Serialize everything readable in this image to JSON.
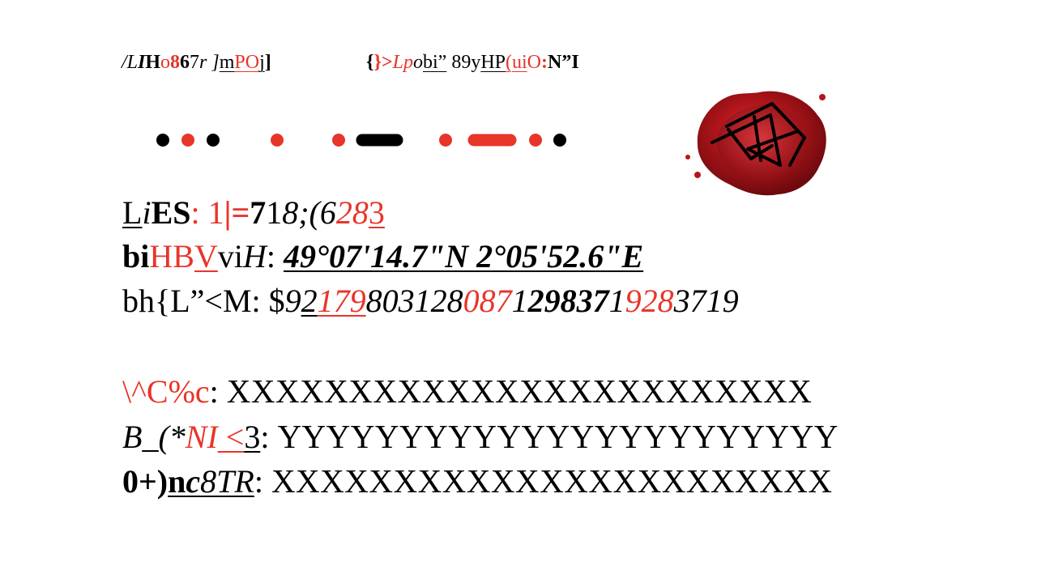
{
  "header": {
    "left": [
      "/",
      "L",
      "I",
      "H",
      "o",
      "8",
      "6",
      "7",
      "r",
      " ]",
      "m",
      "PO",
      "j",
      "]"
    ],
    "right": [
      "{",
      "}",
      ">",
      "Lp",
      "o",
      "bi",
      "”",
      " 89",
      "y",
      "HP",
      "(",
      "ui",
      "O",
      ":",
      "N”I"
    ]
  },
  "morse_colors": {
    "black": "#000000",
    "red": "#e8352a"
  },
  "morse": [
    "dot-black",
    "dot-red",
    "dot-black",
    "dot-red",
    "dot-red",
    "dash-black",
    "dot-red",
    "dash-red",
    "dot-red",
    "dot-black"
  ],
  "seal": {
    "icon": "wax-seal-icon",
    "color": "#b5161b"
  },
  "lines": {
    "l1": [
      "L",
      "i",
      "ES",
      ": 1",
      "|",
      "=",
      "7",
      "1",
      "8;(6",
      "28",
      "3"
    ],
    "l2": [
      "bi",
      "HB",
      "V",
      "vi",
      "H",
      ": ",
      "49°07'14.7\"N 2°05'52.6\"E"
    ],
    "l3": [
      "bh{L”<M: $",
      "9",
      "2",
      "179",
      "803128",
      "087",
      "1",
      "29837",
      "1",
      "928",
      "3719"
    ],
    "l4": [
      "\\^C%c",
      ": ",
      "XXXXXXXXXXXXXXXXXXXXXXXX"
    ],
    "l5": [
      "B",
      "_(*",
      "NI",
      " <",
      "3",
      ": ",
      "YYYYYYYYYYYYYYYYYYYYYYY"
    ],
    "l6": [
      "0+)",
      "n",
      "c",
      "8TR",
      ": ",
      "XXXXXXXXXXXXXXXXXXXXXXX"
    ]
  }
}
